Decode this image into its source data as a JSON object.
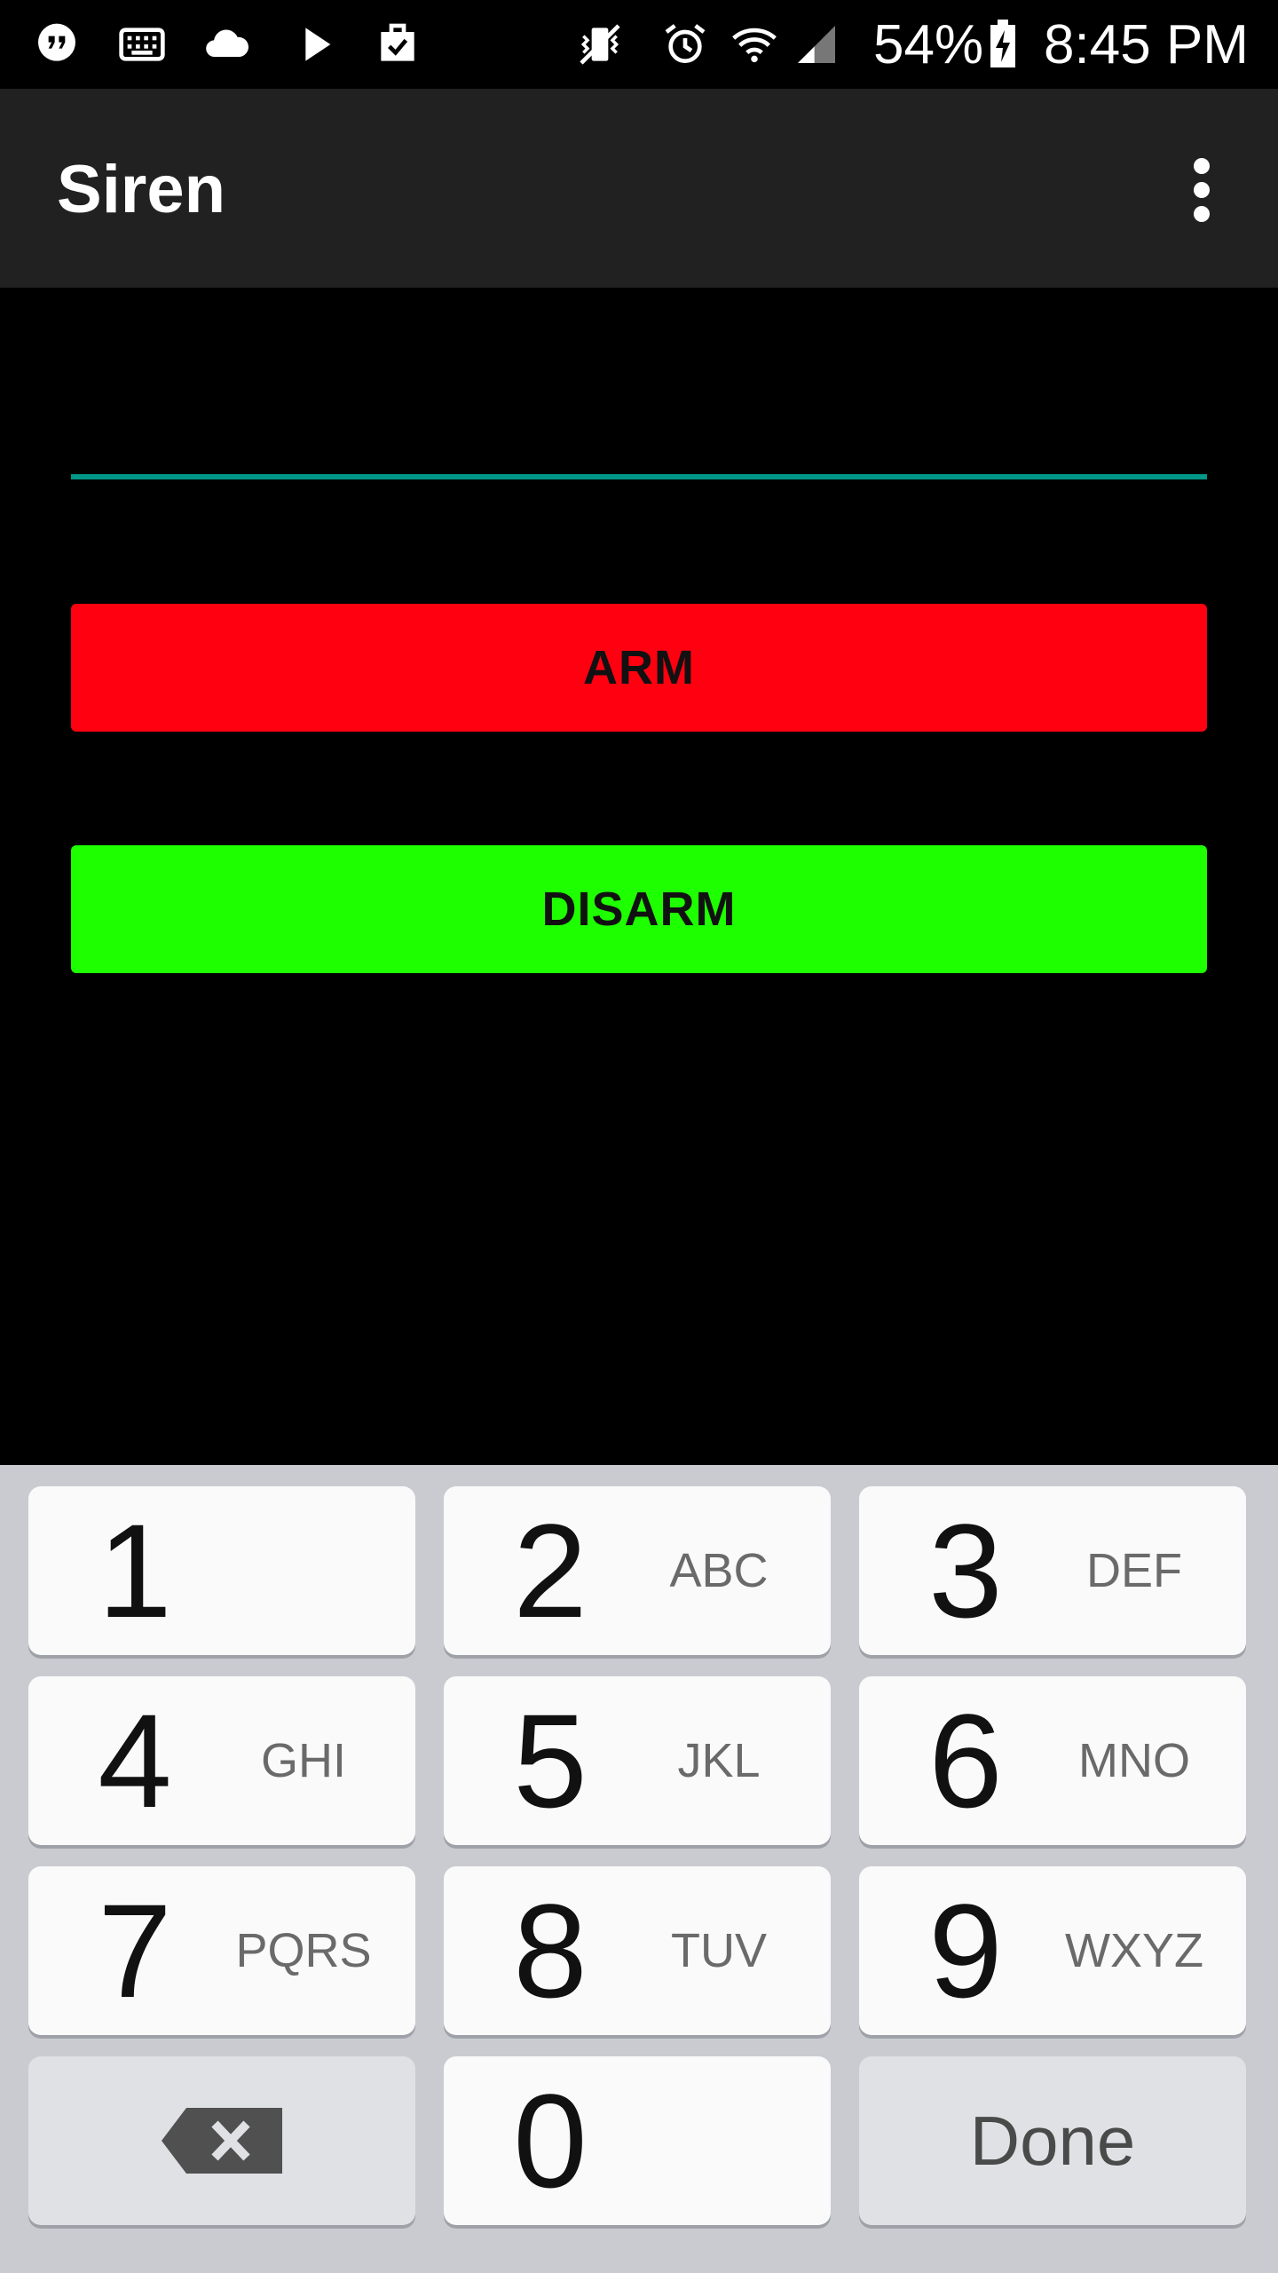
{
  "status_bar": {
    "battery": "54%",
    "time": "8:45 PM",
    "left_icons": [
      "hangouts-icon",
      "keyboard-icon",
      "cloud-icon",
      "play-store-icon",
      "clipboard-check-icon"
    ],
    "right_icons": [
      "vibrate-icon",
      "alarm-icon",
      "wifi-icon",
      "signal-icon",
      "battery-charging-icon"
    ]
  },
  "app_bar": {
    "title": "Siren",
    "overflow_icon": "more-vert-icon"
  },
  "form": {
    "code_value": "",
    "accent_color": "#009688",
    "arm_label": "ARM",
    "arm_color": "#ff0010",
    "disarm_label": "DISARM",
    "disarm_color": "#1eff00"
  },
  "keypad": {
    "keys": [
      {
        "digit": "1",
        "letters": ""
      },
      {
        "digit": "2",
        "letters": "ABC"
      },
      {
        "digit": "3",
        "letters": "DEF"
      },
      {
        "digit": "4",
        "letters": "GHI"
      },
      {
        "digit": "5",
        "letters": "JKL"
      },
      {
        "digit": "6",
        "letters": "MNO"
      },
      {
        "digit": "7",
        "letters": "PQRS"
      },
      {
        "digit": "8",
        "letters": "TUV"
      },
      {
        "digit": "9",
        "letters": "WXYZ"
      },
      {
        "digit": "0",
        "letters": ""
      }
    ],
    "backspace_icon": "backspace-icon",
    "done_label": "Done"
  }
}
